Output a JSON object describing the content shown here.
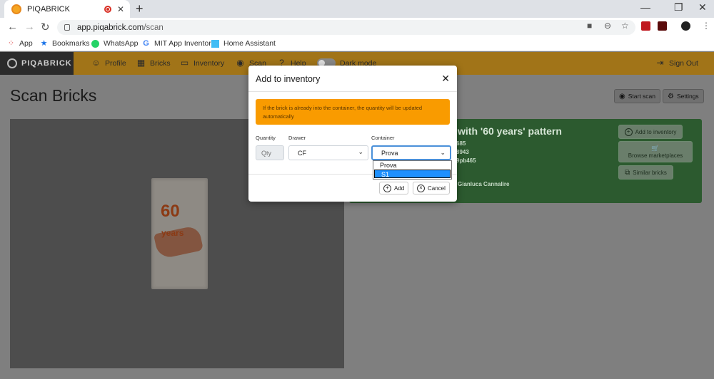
{
  "browser": {
    "tab_title": "PIQABRICK",
    "url_host": "app.piqabrick.com",
    "url_path": "/scan",
    "bookmarks": [
      "App",
      "Bookmarks",
      "WhatsApp",
      "MIT App Inventor",
      "Home Assistant"
    ]
  },
  "nav": {
    "brand": "PIQABRICK",
    "items": [
      "Profile",
      "Bricks",
      "Inventory",
      "Scan",
      "Help",
      "Dark mode"
    ],
    "sign_out": "Sign Out"
  },
  "page": {
    "title": "Scan Bricks",
    "start_scan": "Start scan",
    "settings": "Settings"
  },
  "brick_image": {
    "number": "60",
    "word": "years"
  },
  "result": {
    "title": "with '60 years' pattern",
    "lines": [
      "685",
      "8943",
      "9pb465"
    ],
    "author": "Gianluca Cannalire",
    "buttons": [
      "Add to inventory",
      "Browse marketplaces",
      "Similar bricks"
    ]
  },
  "modal": {
    "title": "Add to inventory",
    "alert": "If the brick is already into the container, the quantity will be updated automatically",
    "labels": {
      "quantity": "Quantity",
      "drawer": "Drawer",
      "container": "Container"
    },
    "quantity_placeholder": "Qty",
    "drawer_value": "CF",
    "container_value": "Prova",
    "container_options": [
      "Prova",
      "S1"
    ],
    "container_highlighted": "S1",
    "add_label": "Add",
    "cancel_label": "Cancel"
  }
}
